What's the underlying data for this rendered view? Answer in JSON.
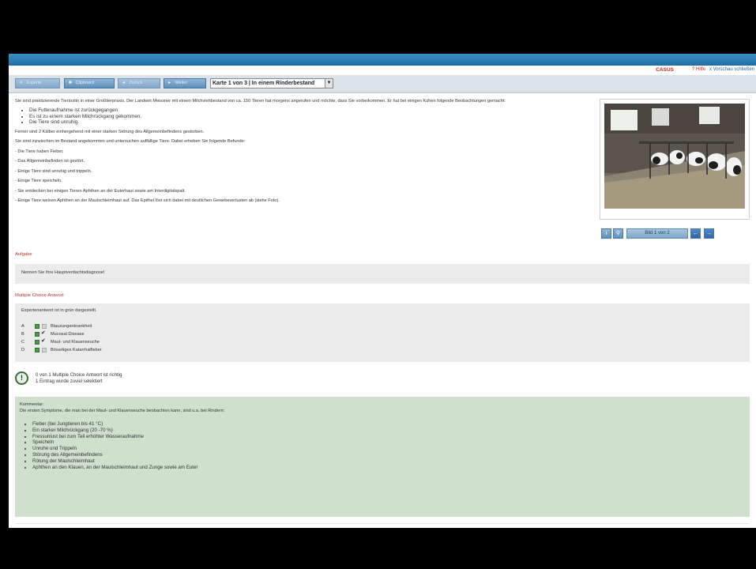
{
  "header": {
    "brand": "CASUS",
    "help": "? Hilfe",
    "close_preview": "x Vorschau schließen"
  },
  "toolbar": {
    "buttons": [
      {
        "label": "Experte",
        "icon": "double-arrow-left-icon"
      },
      {
        "label": "Clipboard",
        "icon": "clipboard-icon"
      },
      {
        "label": "Zurück",
        "icon": "arrow-left-icon"
      },
      {
        "label": "Weiter",
        "icon": "arrow-right-icon"
      }
    ],
    "card_select": "Karte 1 von 3 | In einem Rinderbestand"
  },
  "intro": {
    "p1": "Sie sind praktizierende Tierärztin in einer Großtierpraxis. Der Landwirt Meissner mit einem Milchviehbestand von ca. 150 Tieren hat morgens angerufen und möchte, dass Sie vorbeikommen. Er hat bei einigen Kühen folgende Beobachtungen gemacht:",
    "bullets": [
      "Die Futteraufnahme ist zurückgegangen",
      "Es ist zu einem starken Milchrückgang gekommen.",
      "Die Tiere sind unruhig."
    ],
    "p2": "Ferner sind 2 Kälber einhergehend mit einer starken Störung des Allgemeinbefindens gestorben.",
    "p3": "Sie sind inzwischen im Bestand angekommen und untersuchen auffällige Tiere. Dabei erheben Sie folgende Befunde:",
    "findings": [
      "- Die Tiere haben Fieber.",
      "- Das Allgemeinbefinden ist gestört.",
      "- Einige Tiere sind unruhig und trippeln.",
      "- Einige Tiere speicheln.",
      "- Sie entdecken bei einigen Tieren Aphthen an der Euterhaut sowie am Interdigitalspalt.",
      "- Einige Tiere weisen Aphthen an der Maulschleimhaut auf. Das Epithel löst sich dabei mit deutlichen Gewebeverlusten ab (siehe Foto)."
    ]
  },
  "task": {
    "title": "Aufgabe",
    "text": "Nennen Sie Ihre Hauptverdachtsdiagnose!"
  },
  "mc": {
    "title": "Multiple Choice-Antwort:",
    "legend": "Expertenantwort ist in grün dargestellt.",
    "options": [
      {
        "letter": "A",
        "label": "Blauzungenkrankheit",
        "checked": false
      },
      {
        "letter": "B",
        "label": "Mucosal Disease",
        "checked": true
      },
      {
        "letter": "C",
        "label": "Maul- und Klauenseuche",
        "checked": false
      },
      {
        "letter": "D",
        "label": "Bösartiges Katarrhalfieber",
        "checked": false
      }
    ]
  },
  "result": {
    "icon": "!",
    "line1": "0 von 1 Multiple Choice Antwort ist richtig",
    "line2": "1 Eintrag wurde zuviel selektiert"
  },
  "comment": {
    "title": "Kommentar:",
    "intro": "Die ersten Symptome, die man bei der Maul- und Klauenseuche beobachten kann, sind u.a. bei Rindern:",
    "bullets": [
      "Fieber (bei Jungtieren bis 41 °C)",
      "Ein starker Milchrückgang (20 -70 %)",
      "Fressunlust bei zum Teil erhöhter Wasseraufnahme",
      "Speicheln",
      "Unruhe und Trippeln",
      "Störung des Allgemeinbefindens",
      "Rötung der Maulschleimhaut",
      "Aphthen an den Klauen, an der Maulschleimhaut und Zunge sowie am Euter"
    ]
  },
  "image_nav": {
    "counter": "Bild 1 von 2"
  }
}
